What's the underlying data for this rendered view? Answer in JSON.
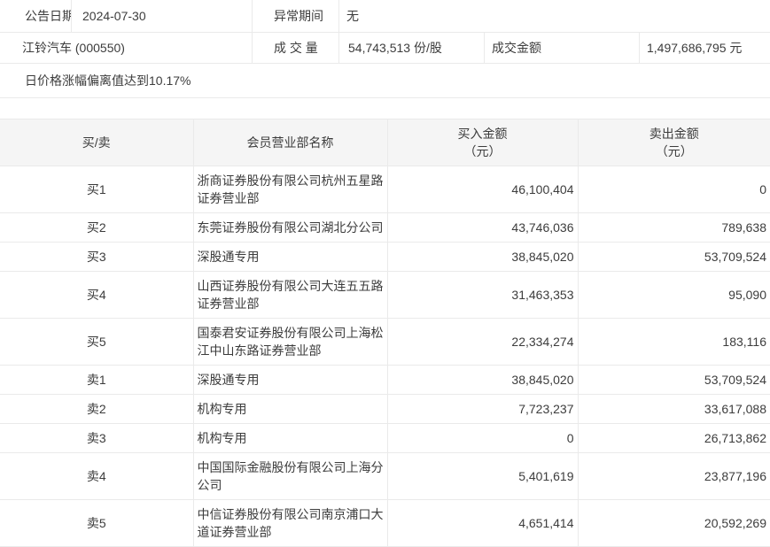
{
  "colors": {
    "header_bg": "#f5f5f5",
    "border": "#eaeaea",
    "text": "#3c3c3c"
  },
  "info": {
    "announce_date_label": "公告日期",
    "announce_date": "2024-07-30",
    "abnormal_period_label": "异常期间",
    "abnormal_period": "无",
    "stock_name": "江铃汽车 (000550)",
    "volume_label": "成 交 量",
    "volume": "54,743,513 份/股",
    "turnover_label": "成交金额",
    "turnover": "1,497,686,795 元",
    "note": "日价格涨幅偏离值达到10.17%"
  },
  "table": {
    "headers": {
      "side": "买/卖",
      "branch": "会员营业部名称",
      "buy": "买入金额",
      "buy_unit": "（元）",
      "sell": "卖出金额",
      "sell_unit": "（元）"
    },
    "rows": [
      {
        "side": "买1",
        "branch": "浙商证券股份有限公司杭州五星路证券营业部",
        "buy": "46,100,404",
        "sell": "0"
      },
      {
        "side": "买2",
        "branch": "东莞证券股份有限公司湖北分公司",
        "buy": "43,746,036",
        "sell": "789,638"
      },
      {
        "side": "买3",
        "branch": "深股通专用",
        "buy": "38,845,020",
        "sell": "53,709,524"
      },
      {
        "side": "买4",
        "branch": "山西证券股份有限公司大连五五路证券营业部",
        "buy": "31,463,353",
        "sell": "95,090"
      },
      {
        "side": "买5",
        "branch": "国泰君安证券股份有限公司上海松江中山东路证券营业部",
        "buy": "22,334,274",
        "sell": "183,116"
      },
      {
        "side": "卖1",
        "branch": "深股通专用",
        "buy": "38,845,020",
        "sell": "53,709,524"
      },
      {
        "side": "卖2",
        "branch": "机构专用",
        "buy": "7,723,237",
        "sell": "33,617,088"
      },
      {
        "side": "卖3",
        "branch": "机构专用",
        "buy": "0",
        "sell": "26,713,862"
      },
      {
        "side": "卖4",
        "branch": "中国国际金融股份有限公司上海分公司",
        "buy": "5,401,619",
        "sell": "23,877,196"
      },
      {
        "side": "卖5",
        "branch": "中信证券股份有限公司南京浦口大道证券营业部",
        "buy": "4,651,414",
        "sell": "20,592,269"
      }
    ]
  }
}
